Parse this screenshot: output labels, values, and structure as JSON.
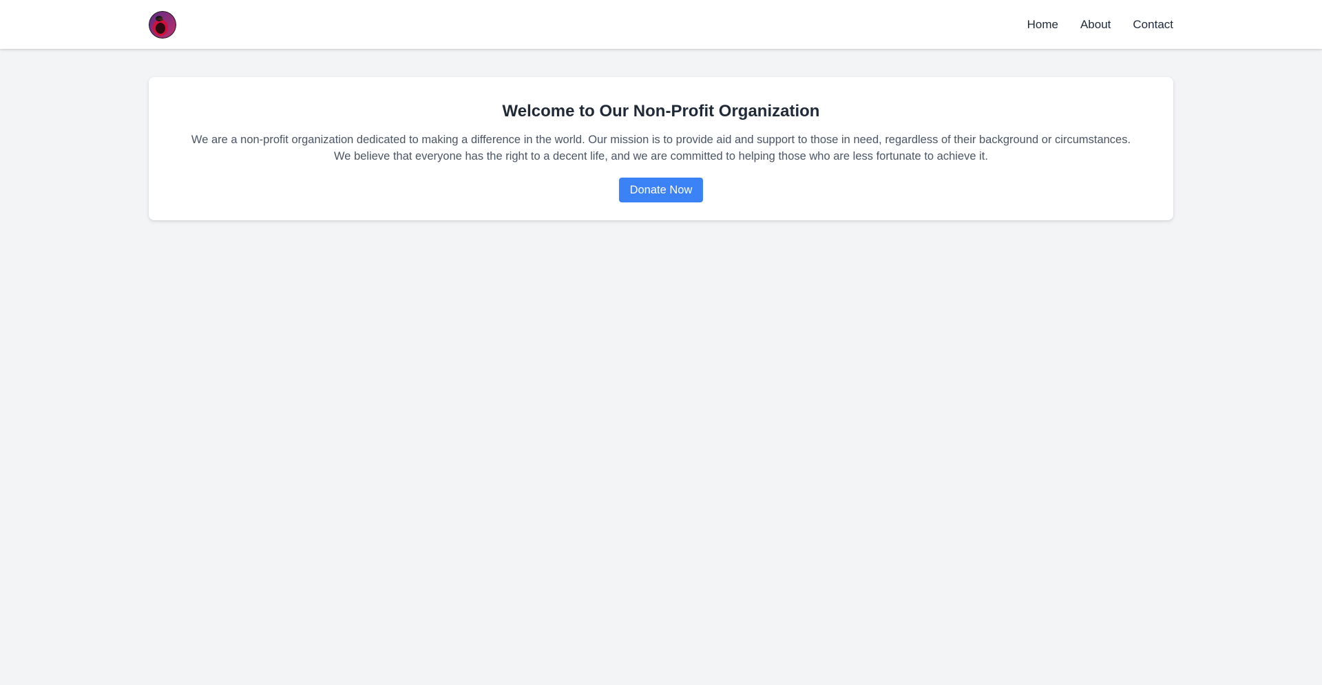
{
  "header": {
    "logo_icon": "avatar-logo-icon",
    "nav": [
      {
        "label": "Home"
      },
      {
        "label": "About"
      },
      {
        "label": "Contact"
      }
    ]
  },
  "hero": {
    "title": "Welcome to Our Non-Profit Organization",
    "description": "We are a non-profit organization dedicated to making a difference in the world. Our mission is to provide aid and support to those in need, regardless of their background or circumstances. We believe that everyone has the right to a decent life, and we are committed to helping those who are less fortunate to achieve it.",
    "button_label": "Donate Now"
  },
  "colors": {
    "background": "#f3f4f6",
    "card": "#ffffff",
    "accent": "#3b82f6",
    "title": "#1f2937",
    "body_text": "#4b5563"
  }
}
